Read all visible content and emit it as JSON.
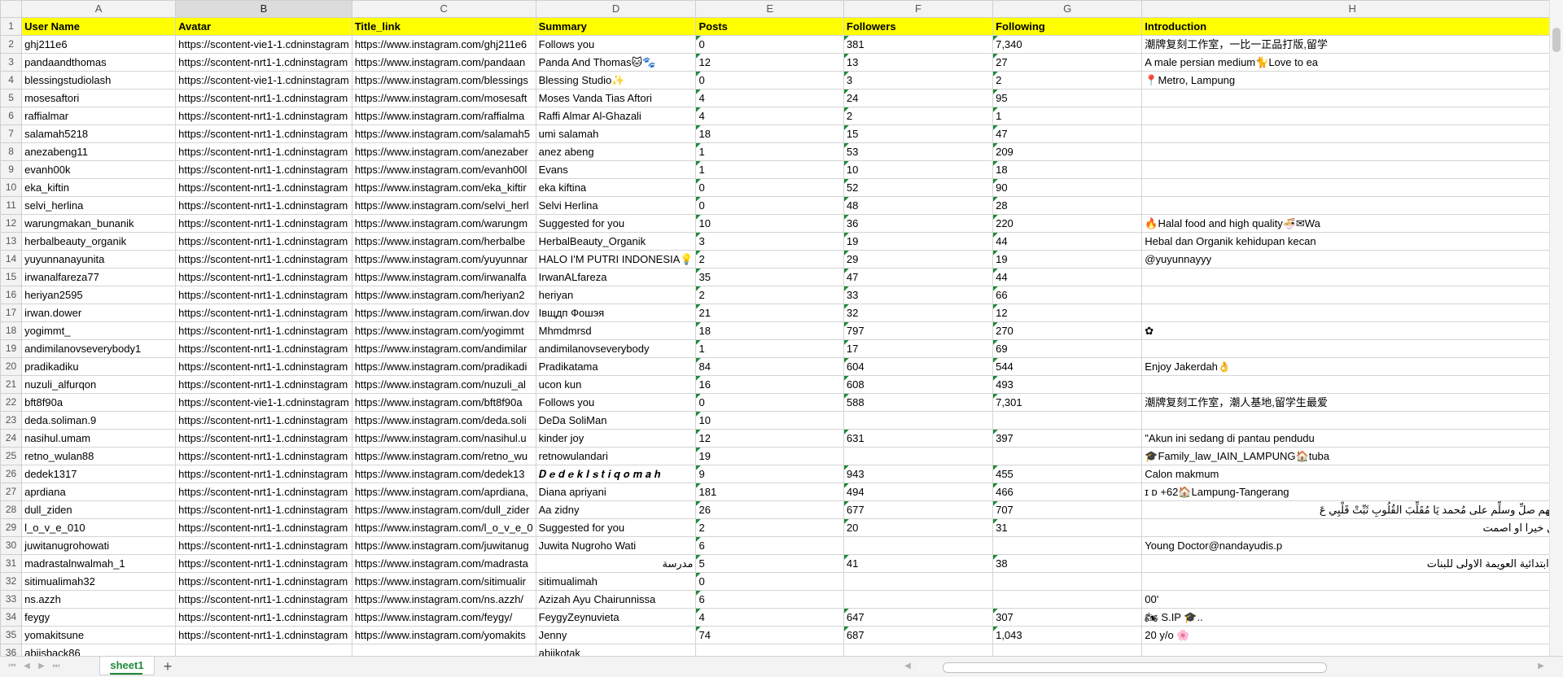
{
  "columns": [
    "A",
    "B",
    "C",
    "D",
    "E",
    "F",
    "G",
    "H"
  ],
  "selected_column": "B",
  "headers": [
    "User Name",
    "Avatar",
    "Title_link",
    "Summary",
    "Posts",
    "Followers",
    "Following",
    "Introduction"
  ],
  "rows": [
    [
      "ghj211e6",
      "https://scontent-vie1-1.cdninstagram",
      "https://www.instagram.com/ghj211e6",
      "Follows you",
      "0",
      "381",
      "7,340",
      "潮牌复刻工作室，一比一正品打版,留学"
    ],
    [
      "pandaandthomas",
      "https://scontent-nrt1-1.cdninstagram",
      "https://www.instagram.com/pandaan",
      "Panda And Thomas🐱🐾",
      "12",
      "13",
      "27",
      "A male persian medium🐈Love to ea"
    ],
    [
      "blessingstudiolash",
      "https://scontent-vie1-1.cdninstagram",
      "https://www.instagram.com/blessings",
      "Blessing Studio✨",
      "0",
      "3",
      "2",
      "📍Metro, Lampung"
    ],
    [
      "mosesaftori",
      "https://scontent-nrt1-1.cdninstagram",
      "https://www.instagram.com/mosesaft",
      "Moses Vanda Tias Aftori",
      "4",
      "24",
      "95",
      ""
    ],
    [
      "raffialmar",
      "https://scontent-nrt1-1.cdninstagram",
      "https://www.instagram.com/raffialma",
      "Raffi Almar Al-Ghazali",
      "4",
      "2",
      "1",
      ""
    ],
    [
      "salamah5218",
      "https://scontent-nrt1-1.cdninstagram",
      "https://www.instagram.com/salamah5",
      "umi salamah",
      "18",
      "15",
      "47",
      ""
    ],
    [
      "anezabeng11",
      "https://scontent-nrt1-1.cdninstagram",
      "https://www.instagram.com/anezaber",
      "anez abeng",
      "1",
      "53",
      "209",
      ""
    ],
    [
      "evanh00k",
      "https://scontent-nrt1-1.cdninstagram",
      "https://www.instagram.com/evanh00l",
      "Evans",
      "1",
      "10",
      "18",
      ""
    ],
    [
      "eka_kiftin",
      "https://scontent-nrt1-1.cdninstagram",
      "https://www.instagram.com/eka_kiftir",
      "eka kiftina",
      "0",
      "52",
      "90",
      ""
    ],
    [
      "selvi_herlina",
      "https://scontent-nrt1-1.cdninstagram",
      "https://www.instagram.com/selvi_herl",
      "Selvi Herlina",
      "0",
      "48",
      "28",
      ""
    ],
    [
      "warungmakan_bunanik",
      "https://scontent-nrt1-1.cdninstagram",
      "https://www.instagram.com/warungm",
      "Suggested for you",
      "10",
      "36",
      "220",
      "🔥Halal food and high quality🍜✉Wa"
    ],
    [
      "herbalbeauty_organik",
      "https://scontent-nrt1-1.cdninstagram",
      "https://www.instagram.com/herbalbe",
      "HerbalBeauty_Organik",
      "3",
      "19",
      "44",
      "Hebal dan Organik kehidupan kecan"
    ],
    [
      "yuyunnanayunita",
      "https://scontent-nrt1-1.cdninstagram",
      "https://www.instagram.com/yuyunnar",
      "HALO I'M PUTRI INDONESIA💡",
      "2",
      "29",
      "19",
      "@yuyunnayyy"
    ],
    [
      "irwanalfareza77",
      "https://scontent-nrt1-1.cdninstagram",
      "https://www.instagram.com/irwanalfa",
      "IrwanALfareza",
      "35",
      "47",
      "44",
      ""
    ],
    [
      "heriyan2595",
      "https://scontent-nrt1-1.cdninstagram",
      "https://www.instagram.com/heriyan2",
      "heriyan",
      "2",
      "33",
      "66",
      ""
    ],
    [
      "irwan.dower",
      "https://scontent-nrt1-1.cdninstagram",
      "https://www.instagram.com/irwan.dov",
      "Івщдп Фошэя",
      "21",
      "32",
      "12",
      ""
    ],
    [
      "yogimmt_",
      "https://scontent-nrt1-1.cdninstagram",
      "https://www.instagram.com/yogimmt",
      "Mhmdmrsd",
      "18",
      "797",
      "270",
      "✿"
    ],
    [
      "andimilanovseverybody1",
      "https://scontent-nrt1-1.cdninstagram",
      "https://www.instagram.com/andimilar",
      "andimilanovseverybody",
      "1",
      "17",
      "69",
      ""
    ],
    [
      "pradikadiku",
      "https://scontent-nrt1-1.cdninstagram",
      "https://www.instagram.com/pradikadi",
      "Pradikatama",
      "84",
      "604",
      "544",
      "Enjoy Jakerdah👌"
    ],
    [
      "nuzuli_alfurqon",
      "https://scontent-nrt1-1.cdninstagram",
      "https://www.instagram.com/nuzuli_al",
      "ucon kun",
      "16",
      "608",
      "493",
      ""
    ],
    [
      "bft8f90a",
      "https://scontent-vie1-1.cdninstagram",
      "https://www.instagram.com/bft8f90a",
      "Follows you",
      "0",
      "588",
      "7,301",
      "潮牌复刻工作室，潮人基地,留学生最爱"
    ],
    [
      "deda.soliman.9",
      "https://scontent-nrt1-1.cdninstagram",
      "https://www.instagram.com/deda.soli",
      "DeDa SoliMan",
      "10",
      "",
      "",
      ""
    ],
    [
      "nasihul.umam",
      "https://scontent-nrt1-1.cdninstagram",
      "https://www.instagram.com/nasihul.u",
      "kinder joy",
      "12",
      "631",
      "397",
      "\"Akun ini sedang di pantau pendudu"
    ],
    [
      "retno_wulan88",
      "https://scontent-nrt1-1.cdninstagram",
      "https://www.instagram.com/retno_wu",
      "retnowulandari",
      "19",
      "",
      "",
      "🎓Family_law_IAIN_LAMPUNG🏠tuba"
    ],
    [
      "dedek1317",
      "https://scontent-nrt1-1.cdninstagram",
      "https://www.instagram.com/dedek13",
      "𝑫 𝒆 𝒅 𝒆 𝒌  𝑰 𝒔 𝒕 𝒊 𝒒 𝒐 𝒎 𝒂 𝒉",
      "9",
      "943",
      "455",
      "Calon makmum"
    ],
    [
      "aprdiana",
      "https://scontent-nrt1-1.cdninstagram",
      "https://www.instagram.com/aprdiana,",
      "Diana apriyani",
      "181",
      "494",
      "466",
      "ɪ ᴅ +62🏠Lampung-Tangerang"
    ],
    [
      "dull_ziden",
      "https://scontent-nrt1-1.cdninstagram",
      "https://www.instagram.com/dull_zider",
      "Aa zidny",
      "26",
      "677",
      "707",
      "اللهم صلِّ وسلِّم على مُحمد يَا مُقَلِّبَ القُلُوبِ ثَبِّتْ قَلْبِي عَ"
    ],
    [
      "l_o_v_e_010",
      "https://scontent-nrt1-1.cdninstagram",
      "https://www.instagram.com/l_o_v_e_0",
      "Suggested for you",
      "2",
      "20",
      "31",
      "قل خيرا او اصمت"
    ],
    [
      "juwitanugrohowati",
      "https://scontent-nrt1-1.cdninstagram",
      "https://www.instagram.com/juwitanug",
      "Juwita Nugroho Wati",
      "6",
      "",
      "",
      "Young Doctor@nandayudis.p"
    ],
    [
      "madrastalnwalmah_1",
      "https://scontent-nrt1-1.cdninstagram",
      "https://www.instagram.com/madrasta",
      "مدرسة",
      "5",
      "41",
      "38",
      "☺ابتدائية العويمة الاولى للبنات"
    ],
    [
      "sitimualimah32",
      "https://scontent-nrt1-1.cdninstagram",
      "https://www.instagram.com/sitimualir",
      "sitimualimah",
      "0",
      "",
      "",
      ""
    ],
    [
      "ns.azzh",
      "https://scontent-nrt1-1.cdninstagram",
      "https://www.instagram.com/ns.azzh/",
      "Azizah Ayu Chairunnissa",
      "6",
      "",
      "",
      "00'"
    ],
    [
      "feygy",
      "https://scontent-nrt1-1.cdninstagram",
      "https://www.instagram.com/feygy/",
      "FeygyZeynuvieta",
      "4",
      "647",
      "307",
      "🏍 S.IP 🎓.."
    ],
    [
      "yomakitsune",
      "https://scontent-nrt1-1.cdninstagram",
      "https://www.instagram.com/yomakits",
      "Jenny",
      "74",
      "687",
      "1,043",
      "20 y/o 🌸"
    ],
    [
      "abiisback86",
      "",
      "",
      "abiikotak",
      "",
      "",
      "",
      ""
    ]
  ],
  "sheet_tab": {
    "label": "sheet1"
  },
  "add_sheet_label": "+",
  "nav_icons": [
    "first-sheet-icon",
    "prev-sheet-icon",
    "next-sheet-icon",
    "last-sheet-icon"
  ]
}
